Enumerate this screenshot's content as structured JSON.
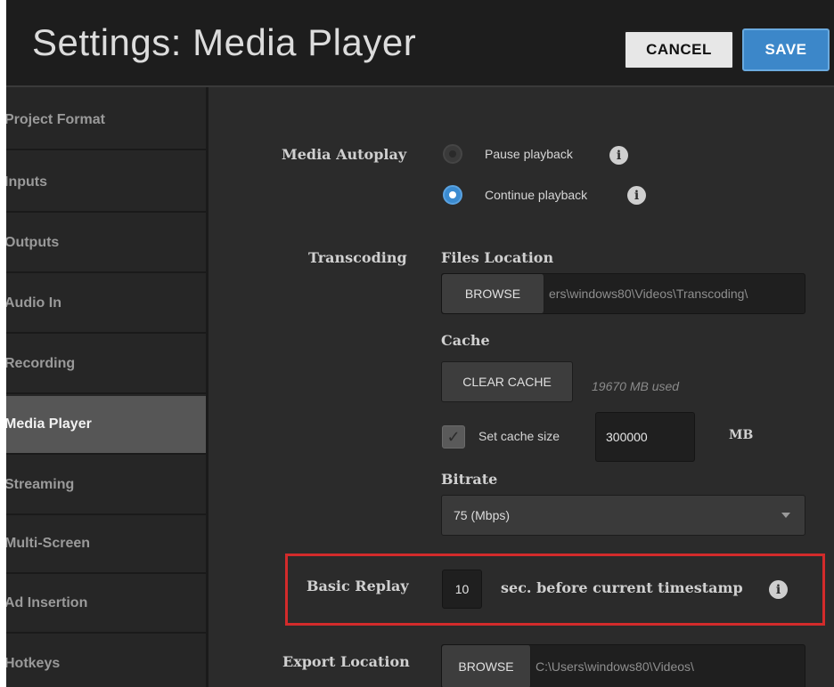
{
  "window": {
    "title": "Settings: Media Player"
  },
  "toolbar": {
    "cancel_label": "CANCEL",
    "save_label": "SAVE"
  },
  "sidebar": {
    "items": [
      {
        "label": "Project Format",
        "active": false
      },
      {
        "label": "Inputs",
        "active": false
      },
      {
        "label": "Outputs",
        "active": false
      },
      {
        "label": "Audio In",
        "active": false
      },
      {
        "label": "Recording",
        "active": false
      },
      {
        "label": "Media Player",
        "active": true
      },
      {
        "label": "Streaming",
        "active": false
      },
      {
        "label": "Multi-Screen",
        "active": false
      },
      {
        "label": "Ad Insertion",
        "active": false
      },
      {
        "label": "Hotkeys",
        "active": false
      }
    ]
  },
  "media_autoplay": {
    "label": "Media Autoplay",
    "options": [
      {
        "label": "Pause playback",
        "selected": false
      },
      {
        "label": "Continue playback",
        "selected": true
      }
    ]
  },
  "transcoding": {
    "label": "Transcoding",
    "files_location_label": "Files Location",
    "browse_label": "BROWSE",
    "files_location_value": "ers\\windows80\\Videos\\Transcoding\\",
    "cache_label": "Cache",
    "clear_cache_label": "CLEAR CACHE",
    "cache_used": "19670 MB used",
    "set_cache_size_label": "Set cache size",
    "set_cache_size_checked": true,
    "cache_size_value": "300000",
    "cache_size_unit": "MB",
    "bitrate_label": "Bitrate",
    "bitrate_value": "75 (Mbps)"
  },
  "basic_replay": {
    "label": "Basic Replay",
    "seconds_value": "10",
    "suffix": "sec. before current timestamp"
  },
  "export_location": {
    "label": "Export Location",
    "browse_label": "BROWSE",
    "value": "C:\\Users\\windows80\\Videos\\"
  },
  "colors": {
    "accent": "#3c87c9",
    "highlight_border": "#d32b2b",
    "background": "#2b2b2b"
  },
  "icons": {
    "info": "info-icon",
    "dropdown": "chevron-down-icon",
    "check": "checkmark-icon"
  }
}
